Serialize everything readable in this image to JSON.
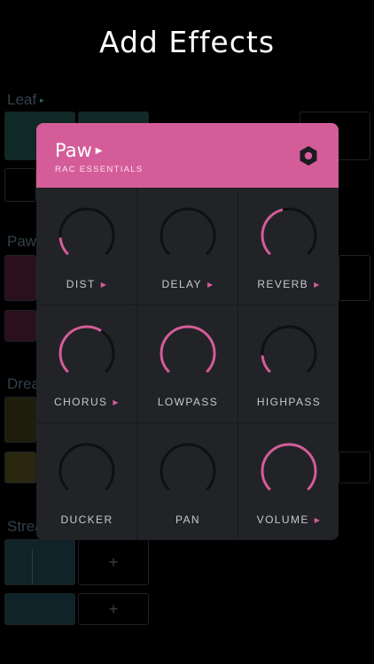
{
  "headline": "Add Effects",
  "background": {
    "sections": [
      {
        "label": "Leaf",
        "color": "#2f4a3f"
      },
      {
        "label": "Paw",
        "color": "#3a1f2c"
      },
      {
        "label": "Dream",
        "color": "#2f2c17"
      },
      {
        "label": "Stream",
        "color": "#1f3a41"
      }
    ],
    "add_label": "+"
  },
  "modal": {
    "title": "Paw",
    "subtitle": "RAC ESSENTIALS",
    "accent": "#d45d99",
    "effects": [
      {
        "label": "DIST",
        "has_arrow": true,
        "level": 0.15
      },
      {
        "label": "DELAY",
        "has_arrow": true,
        "level": 0.0
      },
      {
        "label": "REVERB",
        "has_arrow": true,
        "level": 0.45
      },
      {
        "label": "CHORUS",
        "has_arrow": true,
        "level": 0.62
      },
      {
        "label": "LOWPASS",
        "has_arrow": false,
        "level": 1.0
      },
      {
        "label": "HIGHPASS",
        "has_arrow": false,
        "level": 0.15
      },
      {
        "label": "DUCKER",
        "has_arrow": false,
        "level": 0.0
      },
      {
        "label": "PAN",
        "has_arrow": false,
        "level": 0.0
      },
      {
        "label": "VOLUME",
        "has_arrow": true,
        "level": 1.0
      }
    ]
  }
}
